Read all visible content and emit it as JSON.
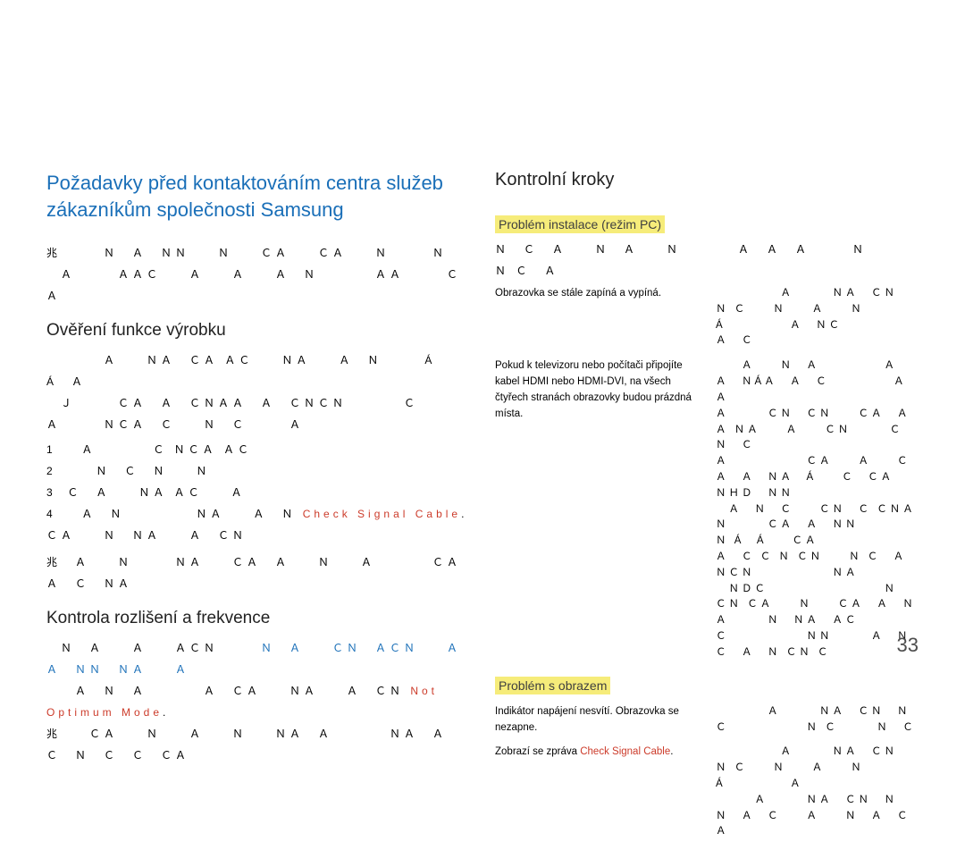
{
  "left": {
    "h1_line1": "Požadavky před kontaktováním centra služeb",
    "h1_line2": "zákazníkům společnosti Samsung",
    "intro_garble": "兆　　　Ｎ　Ａ　ＮＮ　　Ｎ　　ＣＡ　　ＣＡ　　Ｎ　　　Ｎ",
    "intro_garble2": "　Ａ　　　ＡＡＣ　　Ａ　　Ａ　　Ａ　Ｎ　　　　ＡＡ　　　Ｃ　Ａ",
    "sec1_title": "Ověření funkce výrobku",
    "sec1_garble1": "　　　　Ａ　　ＮＡ　ＣＡ ＡＣ　　ＮＡ　　Ａ　Ｎ　　　Á　　Á　Ａ",
    "sec1_garble2": "　Ｊ　　　ＣＡ　Ａ　ＣＮＡＡ　Ａ　ＣＮＣＮ　　　　Ｃ　",
    "sec1_garble3": "Ａ　　　ＮＣＡ　Ｃ　　Ｎ　Ｃ　　　Ａ",
    "steps": [
      "　Ａ　　　　Ｃ ＮＣＡ ＡＣ",
      "　　Ｎ　Ｃ　Ｎ　　Ｎ",
      "Ｃ　Ａ　　ＮＡ ＡＣ　　Ａ",
      "　Ａ　Ｎ　　　　　ＮＡ　　Ａ　Ｎ"
    ],
    "step4_red": "Check Signal Cable",
    "step4_after": ".　ＣＡ　　Ｎ　ＮＡ　　Ａ　ＣＮ",
    "sec1_garble_end": "兆　Ａ　　Ｎ　　　ＮＡ　　ＣＡ　Ａ　　Ｎ　　Ａ　　　　ＣＡ　Ａ　Ｃ　ＮＡ",
    "sec2_title": "Kontrola rozlišení a frekvence",
    "sec2_garble1": "　Ｎ　Ａ　　Ａ　　ＡＣＮ　　　",
    "sec2_blue": "Ｎ　Ａ　　ＣＮ　ＡＣＮ　　Ａ　　Ａ　ＮＮ　ＮＡ　　Ａ",
    "sec2_garble2": "　　Ａ　Ｎ　Ａ　　　　Ａ　ＣＡ　　ＮＡ　　Ａ　ＣＮ ",
    "sec2_red": "Not Optimum Mode",
    "sec2_dot": ".",
    "sec2_garble3": "兆　　ＣＡ　　Ｎ　　Ａ　　Ｎ　　ＮＡ　Ａ　　　　ＮＡ　Ａ　　　　　　Ｃ　Ｎ　Ｃ　Ｃ　ＣＡ"
  },
  "right": {
    "h2": "Kontrolní kroky",
    "sub1": "Problém instalace (režim PC)",
    "rows1": [
      {
        "left": "Obrazovka se stále zapíná a vypíná.",
        "right_garble": "　　　　　Ａ　　　ＮＡ　ＣＮ　Ｎ Ｃ　　Ｎ　　Ａ　　Ｎ　　　　Á　　　　　Ａ　ＮＣ<br>Ａ　Ｃ"
      },
      {
        "left": "Pokud k televizoru nebo počítači připojíte kabel HDMI nebo HDMI-DVI, na všech čtyřech stranách obrazovky budou prázdná místa.",
        "right_garble": "　　Ａ　　Ｎ　Ａ　　　　　Ａ　Ａ　ＮÁＡ　Ａ　Ｃ　　　　　Ａ　Ａ<br>Ａ　　　ＣＮ　ＣＮ　　ＣＡ　Ａ　　Ａ ＮＡ　　Ａ　　ＣＮ　　　Ｃ　　　　　Ｎ　Ｃ<br>Ａ　　　　　　ＣＡ　　Ａ　　ＣＡ　Ａ　ＮＡ　Á　　Ｃ　ＣＡ　　　　　ＮＨＤ　ＮＮ<br>　Ａ　Ｎ　Ｃ　　ＣＮ　Ｃ ＣＮＡ　　　Ｎ　　　ＣＡ　Ａ　ＮＮ　　　　Ｎ Á　Á　　ＣＡ<br>Ａ　Ｃ Ｃ Ｎ ＣＮ　　Ｎ Ｃ　Ａ　ＮＣＮ　　　　　　ＮＡ<br>　ＮＤＣ　　　　　　　　　Ｎ　ＣＮ ＣＡ　　Ｎ　　ＣＡ　Ａ　ＮＡ　　　Ｎ　ＮＡ　ＡＣ<br>Ｃ　　　　　　ＮＮ　　　Ａ　Ｎ　Ｃ　Ａ　Ｎ ＣＮ Ｃ"
      }
    ],
    "sub2": "Problém s obrazem",
    "rows2": [
      {
        "left": "Indikátor napájení nesvítí. Obrazovka se nezapne.",
        "right_garble": "　　　　Ａ　　　ＮＡ　ＣＮ　Ｎ Ｃ　　　　　　Ｎ Ｃ　　　Ｎ　Ｃ"
      },
      {
        "left_prefix": "Zobrazí se zpráva ",
        "left_red": "Check Signal Cable",
        "left_dot": ".",
        "right_garble": "　　　　　Ａ　　　ＮＡ　ＣＮ　Ｎ Ｃ　　Ｎ　　Ａ　　Ｎ　　　　Á　　　　　Ａ<br>　　　Ａ　　　ＮＡ　ＣＮ　Ｎ　　　　　Ｎ　Ａ　Ｃ　　Ａ　　Ｎ　Ａ　Ｃ　Ａ"
      }
    ]
  },
  "page_num": "33"
}
